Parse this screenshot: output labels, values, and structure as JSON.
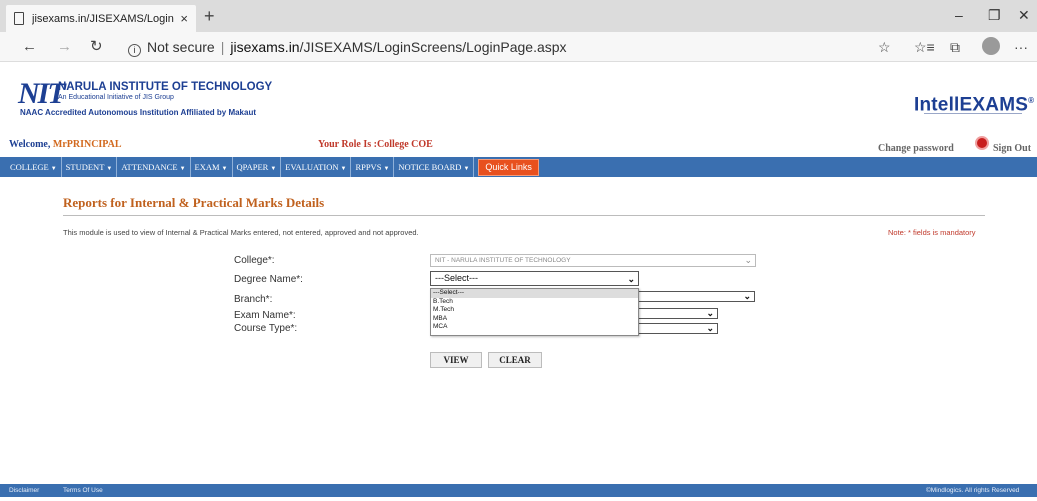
{
  "browser": {
    "tab_title": "jisexams.in/JISEXAMS/LoginScre",
    "tab_close": "×",
    "new_tab": "+",
    "url_prefix": "Not secure",
    "url_host": "jisexams.in",
    "url_path": "/JISEXAMS/LoginScreens/LoginPage.aspx",
    "controls": {
      "minimize": "–",
      "maximize": "❐",
      "close": "✕"
    },
    "nav": {
      "back": "←",
      "forward": "→",
      "refresh": "↻"
    },
    "toolbar": {
      "favorite": "☆",
      "favorites_bar": "☆≡",
      "collections": "⧉",
      "more": "···"
    }
  },
  "header": {
    "logo_mark": "NIT",
    "institute_name": "NARULA INSTITUTE OF TECHNOLOGY",
    "institute_sub": "An Educational Initiative of JIS Group",
    "accreditation": "NAAC Accredited Autonomous Institution Affiliated by Makaut",
    "brand": "IntellEXAMS",
    "brand_mark": "®"
  },
  "user_bar": {
    "welcome_label": "Welcome,",
    "username": "MrPRINCIPAL",
    "role": "Your Role Is :College COE",
    "change_password": "Change password",
    "sign_out": "Sign Out"
  },
  "nav": {
    "items": [
      {
        "label": "COLLEGE",
        "caret": "▼"
      },
      {
        "label": "STUDENT",
        "caret": "▼"
      },
      {
        "label": "ATTENDANCE",
        "caret": "▼"
      },
      {
        "label": "EXAM",
        "caret": "▼"
      },
      {
        "label": "QPAPER",
        "caret": "▼"
      },
      {
        "label": "EVALUATION",
        "caret": "▼"
      },
      {
        "label": "RPPVS",
        "caret": "▼"
      },
      {
        "label": "NOTICE BOARD",
        "caret": "▼"
      }
    ],
    "quick_links": "Quick Links"
  },
  "page": {
    "title": "Reports for Internal & Practical Marks Details",
    "description": "This module is used to view of Internal & Practical Marks entered, not entered, approved and not approved.",
    "note": "Note: * fields is mandatory"
  },
  "form": {
    "college_label": "College*:",
    "college_value": "NIT - NARULA INSTITUTE OF TECHNOLOGY",
    "degree_label": "Degree Name*:",
    "degree_value": "---Select---",
    "branch_label": "Branch*:",
    "exam_label": "Exam Name*:",
    "course_label": "Course Type*:",
    "degree_options": [
      "---Select---",
      "B.Tech",
      "M.Tech",
      "MBA",
      "MCA"
    ],
    "view_button": "VIEW",
    "clear_button": "CLEAR"
  },
  "footer": {
    "disclaimer": "Disclaimer",
    "terms": "Terms Of Use",
    "copyright": "©Mindlogics. All rights Reserved"
  },
  "colors": {
    "nav_blue": "#3a6fb0",
    "brand_blue": "#1d3f93",
    "title_orange": "#c0611e",
    "quick_links_orange": "#e8501e",
    "role_red": "#c0392b"
  }
}
